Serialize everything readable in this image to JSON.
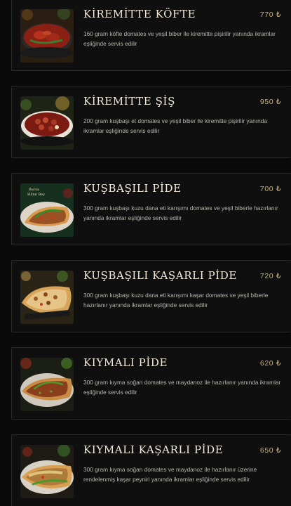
{
  "menu": {
    "items": [
      {
        "title": "KİREMİTTE KÖFTE",
        "price": "770 ₺",
        "description": "160 gram köfte domates ve yeşil biber ile kiremitte pişirilir yanında ikramlar eşliğinde servis edilir",
        "image": "kiremitte-kofte-photo"
      },
      {
        "title": "KİREMİTTE ŞİŞ",
        "price": "950 ₺",
        "description": "200 gram kuşbaşı et domates ve yeşil biber ile kiremitte pişirilir yanında ikramlar eşliğinde servis edilir",
        "image": "kiremitte-sis-photo"
      },
      {
        "title": "KUŞBAŞILI PİDE",
        "price": "700 ₺",
        "description": "300 gram kuşbaşı kuzu dana eti karışımı domates ve yeşil biberle hazırlanır yanında ikramlar eşliğinde servis edilir",
        "image": "kusbasili-pide-photo",
        "photo_logo_text": [
          "Bursa",
          "Hilmi Bey"
        ]
      },
      {
        "title": "KUŞBAŞILI KAŞARLI PİDE",
        "price": "720 ₺",
        "description": "300 gram kuşbaşı kuzu dana eti karışımı kaşar domates ve yeşil biberle hazırlanır yanında ikramlar eşliğinde servis edilir",
        "image": "kusbasili-kasarli-pide-photo"
      },
      {
        "title": "KIYMALI PİDE",
        "price": "620 ₺",
        "description": "300 gram kıyma soğan domates ve maydanoz ile hazırlanır yanında ikramlar eşliğinde servis edilir",
        "image": "kiymali-pide-photo"
      },
      {
        "title": "KIYMALI KAŞARLI PİDE",
        "price": "650 ₺",
        "description": "300 gram kıyma soğan domates ve maydanoz ile hazırlanır üzerine rendelenmiş kaşar peyniri yanında ikramlar eşliğinde servis edilir",
        "image": "kiymali-kasarli-pide-photo"
      }
    ]
  },
  "colors": {
    "background": "#0a0a0a",
    "card": "#0f0f0f",
    "card_border": "#2a2a26",
    "title": "#f4eadc",
    "price": "#c8b07a",
    "description": "#b9b4ac"
  }
}
